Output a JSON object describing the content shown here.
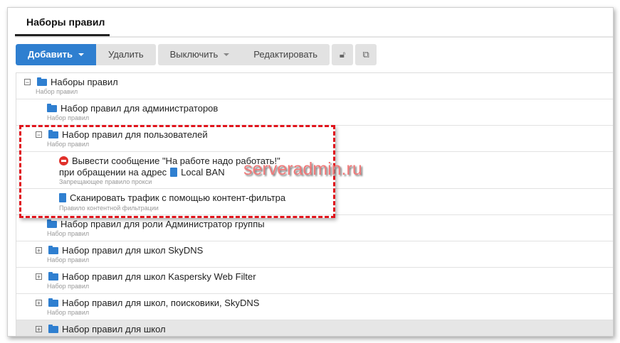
{
  "tab": {
    "label": "Наборы правил"
  },
  "toolbar": {
    "add": "Добавить",
    "delete": "Удалить",
    "disable": "Выключить",
    "edit": "Редактировать"
  },
  "rows": [
    {
      "title": "Наборы правил",
      "sub": "Набор правил"
    },
    {
      "title": "Набор правил для администраторов",
      "sub": "Набор правил"
    },
    {
      "title": "Набор правил для пользователей",
      "sub": "Набор правил"
    },
    {
      "title1": "Вывести сообщение \"На работе надо работать!\"",
      "title2": "при обращении на адрес",
      "link": "Local BAN",
      "sub": "Запрещающее правило прокси"
    },
    {
      "title": "Сканировать трафик с помощью контент-фильтра",
      "sub": "Правило контентной фильтрации"
    },
    {
      "title": "Набор правил для роли Администратор группы",
      "sub": "Набор правил"
    },
    {
      "title": "Набор правил для школ SkyDNS",
      "sub": "Набор правил"
    },
    {
      "title": "Набор правил для школ Kaspersky Web Filter",
      "sub": "Набор правил"
    },
    {
      "title": "Набор правил для школ, поисковики, SkyDNS",
      "sub": "Набор правил"
    },
    {
      "title": "Набор правил для школ"
    }
  ],
  "watermark": "serveradmin.ru"
}
